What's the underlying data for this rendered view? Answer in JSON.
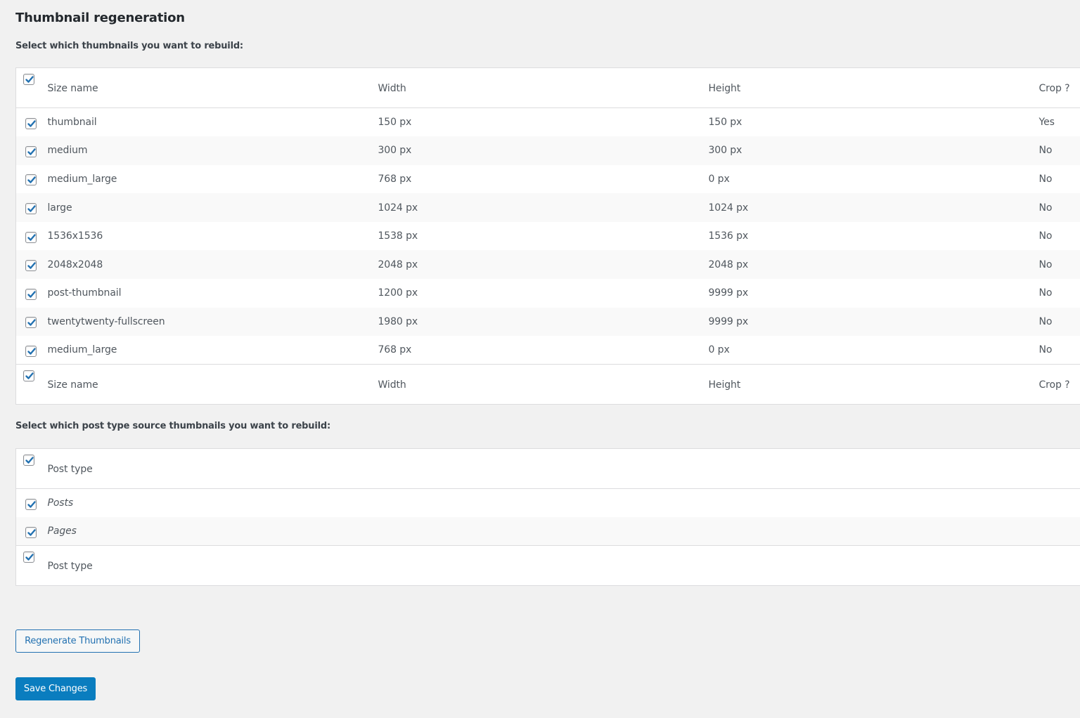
{
  "page": {
    "title": "Thumbnail regeneration",
    "sizes_description": "Select which thumbnails you want to rebuild:",
    "post_types_description": "Select which post type source thumbnails you want to rebuild:"
  },
  "sizes_table": {
    "columns": {
      "name": "Size name",
      "width": "Width",
      "height": "Height",
      "crop": "Crop ?"
    },
    "select_all_checked": true,
    "rows": [
      {
        "name": "thumbnail",
        "width": "150 px",
        "height": "150 px",
        "crop": "Yes",
        "checked": true
      },
      {
        "name": "medium",
        "width": "300 px",
        "height": "300 px",
        "crop": "No",
        "checked": true
      },
      {
        "name": "medium_large",
        "width": "768 px",
        "height": "0 px",
        "crop": "No",
        "checked": true
      },
      {
        "name": "large",
        "width": "1024 px",
        "height": "1024 px",
        "crop": "No",
        "checked": true
      },
      {
        "name": "1536x1536",
        "width": "1538 px",
        "height": "1536 px",
        "crop": "No",
        "checked": true
      },
      {
        "name": "2048x2048",
        "width": "2048 px",
        "height": "2048 px",
        "crop": "No",
        "checked": true
      },
      {
        "name": "post-thumbnail",
        "width": "1200 px",
        "height": "9999 px",
        "crop": "No",
        "checked": true
      },
      {
        "name": "twentytwenty-fullscreen",
        "width": "1980 px",
        "height": "9999 px",
        "crop": "No",
        "checked": true
      },
      {
        "name": "medium_large",
        "width": "768 px",
        "height": "0 px",
        "crop": "No",
        "checked": true
      }
    ]
  },
  "post_types_table": {
    "columns": {
      "name": "Post type"
    },
    "select_all_checked": true,
    "rows": [
      {
        "name": "Posts",
        "checked": true
      },
      {
        "name": "Pages",
        "checked": true
      }
    ]
  },
  "buttons": {
    "regenerate": "Regenerate Thumbnails",
    "save": "Save Changes"
  },
  "colors": {
    "accent": "#2271b1",
    "primary_button": "#0a7dbf",
    "background": "#f1f1f1"
  }
}
